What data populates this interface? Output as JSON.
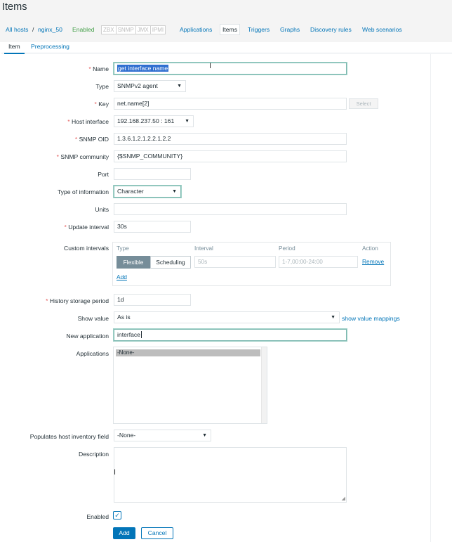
{
  "page": {
    "title": "Items"
  },
  "nav": {
    "all_hosts": "All hosts",
    "separator": "/",
    "host": "nginx_50",
    "status": "Enabled",
    "availability": [
      "ZBX",
      "SNMP",
      "JMX",
      "IPMI"
    ],
    "links": [
      "Applications",
      "Items",
      "Triggers",
      "Graphs",
      "Discovery rules",
      "Web scenarios"
    ]
  },
  "tabs": {
    "item": "Item",
    "preprocessing": "Preprocessing"
  },
  "form": {
    "required_mark": "*",
    "name": {
      "label": "Name",
      "value": "get interface name"
    },
    "type": {
      "label": "Type",
      "value": "SNMPv2 agent"
    },
    "key": {
      "label": "Key",
      "value": "net.name[2]",
      "button": "Select"
    },
    "host_interface": {
      "label": "Host interface",
      "value": "192.168.237.50 : 161"
    },
    "snmp_oid": {
      "label": "SNMP OID",
      "value": "1.3.6.1.2.1.2.2.1.2.2"
    },
    "snmp_community": {
      "label": "SNMP community",
      "value": "{$SNMP_COMMUNITY}"
    },
    "port": {
      "label": "Port",
      "value": ""
    },
    "type_of_information": {
      "label": "Type of information",
      "value": "Character"
    },
    "units": {
      "label": "Units",
      "value": ""
    },
    "update_interval": {
      "label": "Update interval",
      "value": "30s"
    },
    "custom_intervals": {
      "label": "Custom intervals",
      "headers": [
        "Type",
        "Interval",
        "Period",
        "Action"
      ],
      "row": {
        "flexible": "Flexible",
        "scheduling": "Scheduling",
        "interval": "50s",
        "period": "1-7,00:00-24:00",
        "remove": "Remove"
      },
      "add": "Add"
    },
    "history_storage_period": {
      "label": "History storage period",
      "value": "1d"
    },
    "show_value": {
      "label": "Show value",
      "value": "As is",
      "link": "show value mappings"
    },
    "new_application": {
      "label": "New application",
      "value": "interface"
    },
    "applications": {
      "label": "Applications",
      "options": [
        "-None-"
      ]
    },
    "populates_host_inventory_field": {
      "label": "Populates host inventory field",
      "value": "-None-"
    },
    "description": {
      "label": "Description",
      "value": ""
    },
    "enabled": {
      "label": "Enabled",
      "checked": true
    }
  },
  "buttons": {
    "add": "Add",
    "cancel": "Cancel"
  },
  "colors": {
    "link": "#0275b8",
    "enabled": "#429e47",
    "required": "#e45959",
    "primary_button": "#0275b8"
  }
}
